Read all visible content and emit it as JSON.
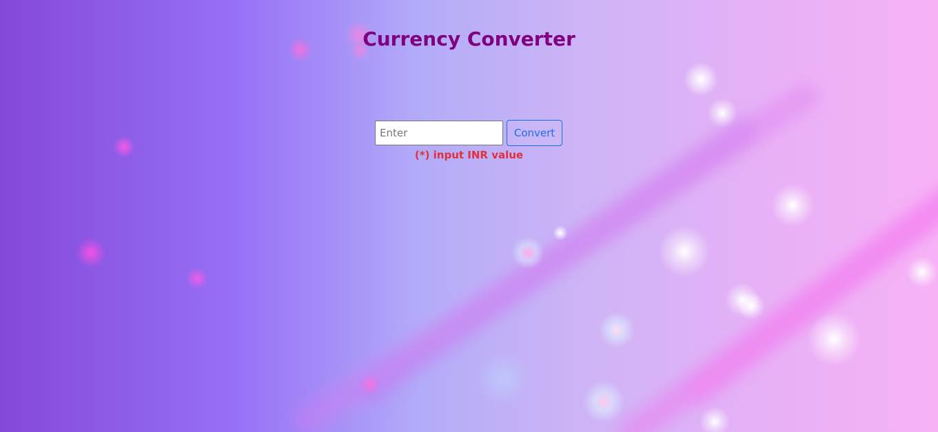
{
  "page": {
    "title": "Currency Converter"
  },
  "converter": {
    "input_placeholder": "Enter",
    "input_value": "",
    "convert_label": "Convert",
    "hint": "(*) input INR value"
  },
  "colors": {
    "title": "#800080",
    "hint": "#e0303c",
    "button_accent": "#1a6fe8"
  }
}
